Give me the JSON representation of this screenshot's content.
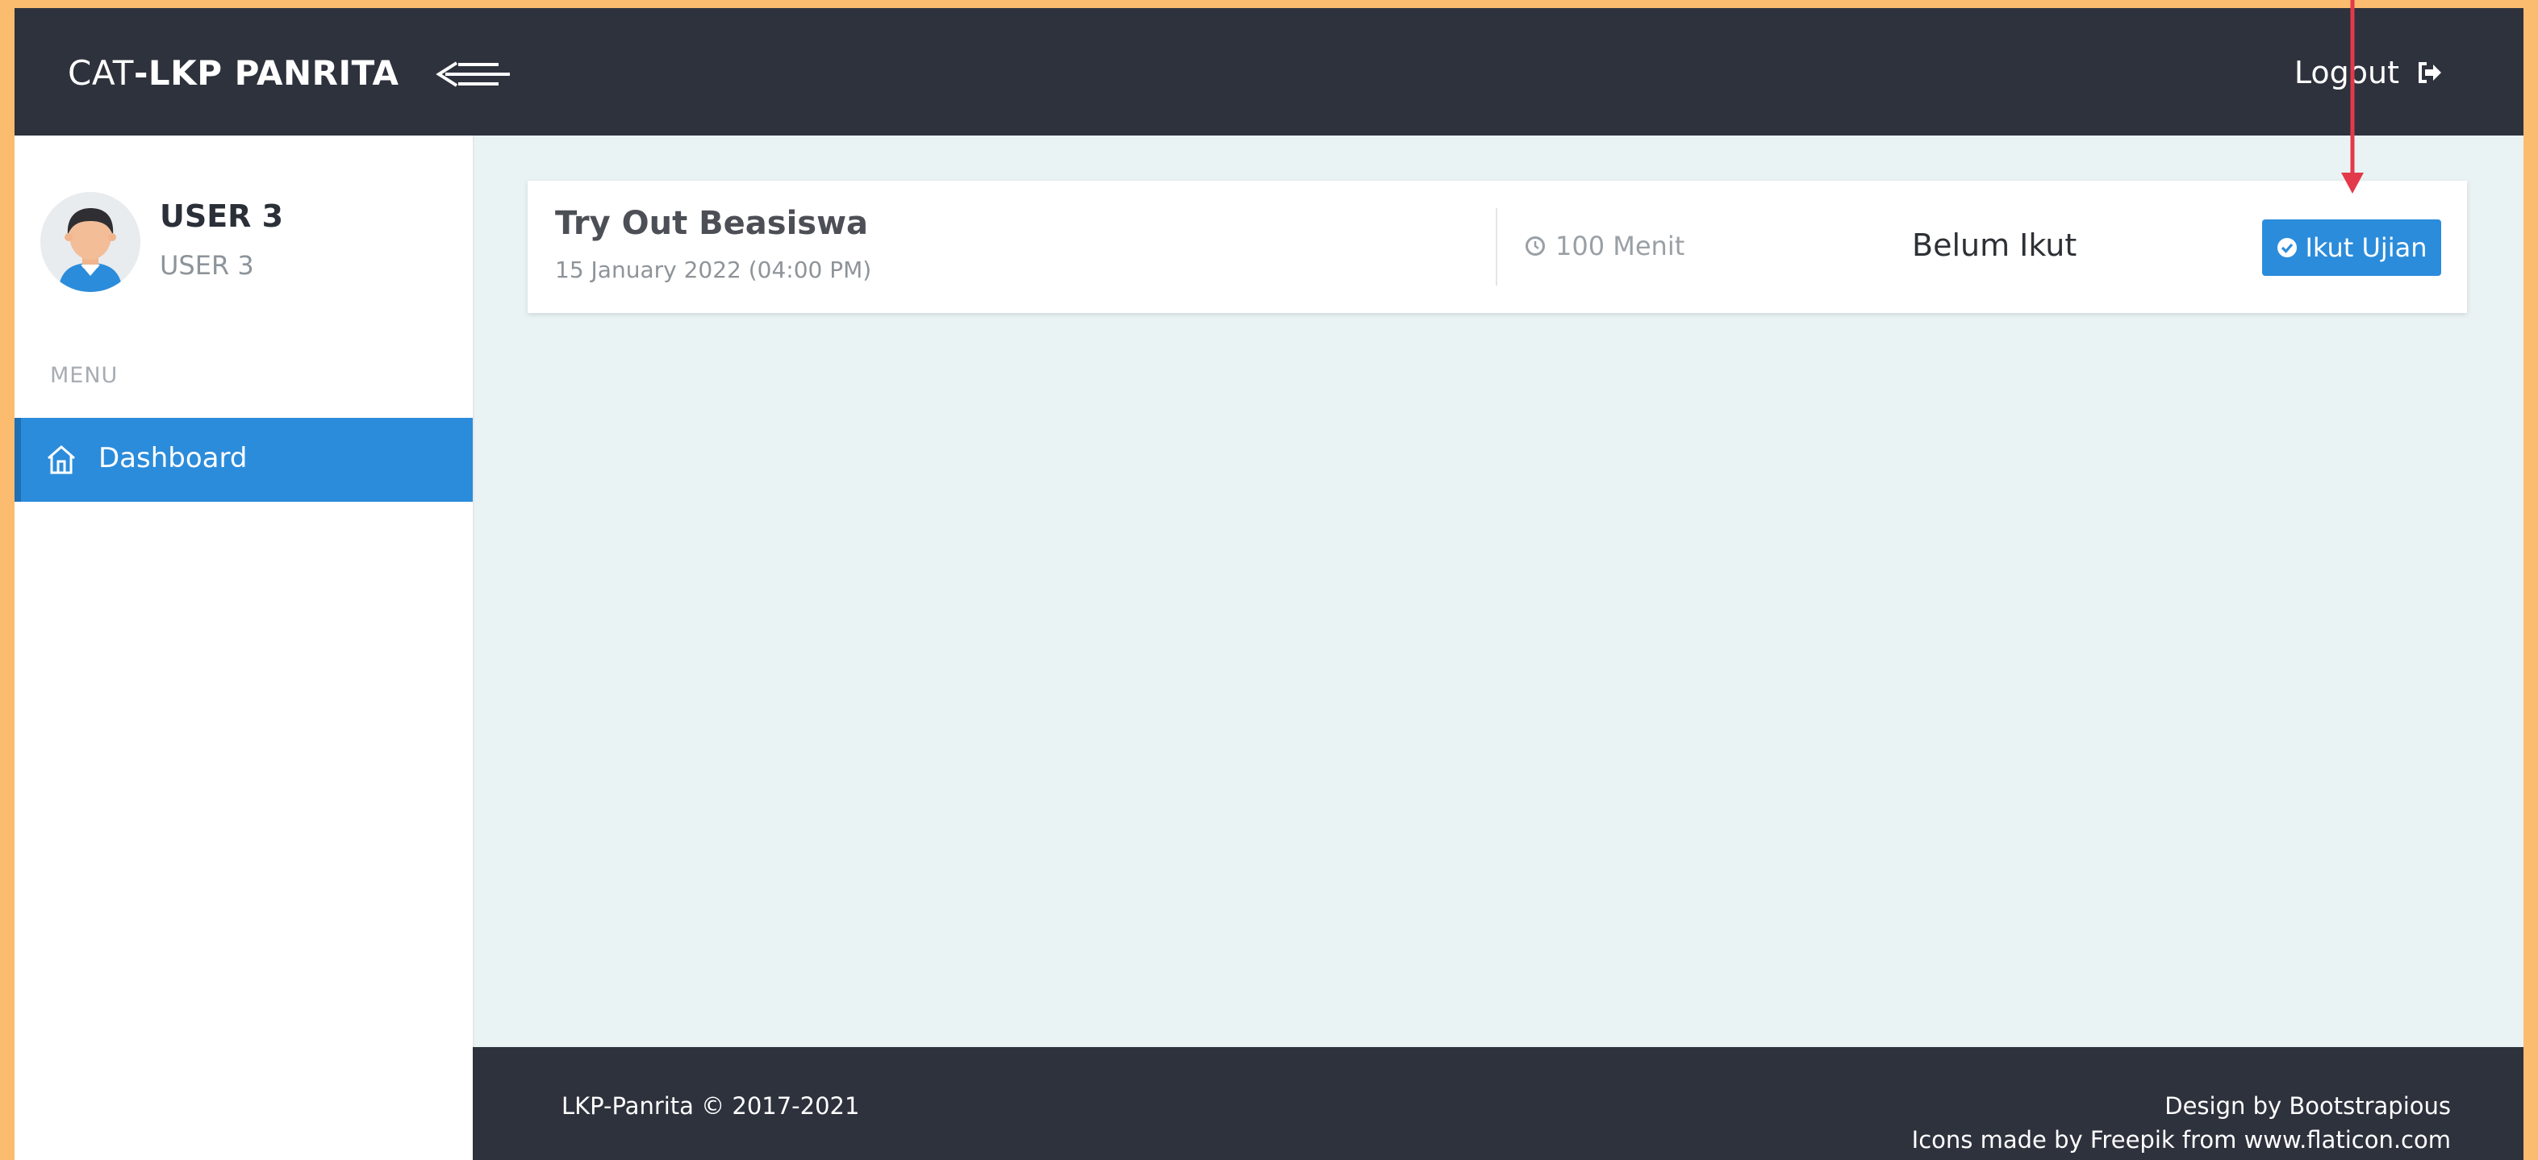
{
  "header": {
    "brand_prefix": "CAT",
    "brand_dash": "-",
    "brand_name": "LKP PANRITA",
    "menu_toggle_icon": "menu-toggle-icon",
    "logout_label": "Logout",
    "logout_icon": "sign-out-icon"
  },
  "sidebar": {
    "user_name": "USER 3",
    "user_role": "USER 3",
    "menu_label": "MENU",
    "items": [
      {
        "label": "Dashboard",
        "icon": "home-icon",
        "active": true
      }
    ]
  },
  "exam": {
    "title": "Try Out Beasiswa",
    "date": "15 January 2022 (04:00 PM)",
    "duration": "100 Menit",
    "duration_icon": "clock-icon",
    "status": "Belum Ikut",
    "action_label": "Ikut Ujian",
    "action_icon": "check-circle-icon"
  },
  "footer": {
    "copyright": "LKP-Panrita © 2017-2021",
    "design_credit": "Design by Bootstrapious",
    "icons_credit": "Icons made by Freepik from www.flaticon.com"
  },
  "colors": {
    "outer_border": "#fcbc6f",
    "topbar": "#2e323d",
    "accent": "#2b8cdb",
    "content_bg": "#eaf3f4",
    "annotation_arrow": "#e23a4a"
  }
}
